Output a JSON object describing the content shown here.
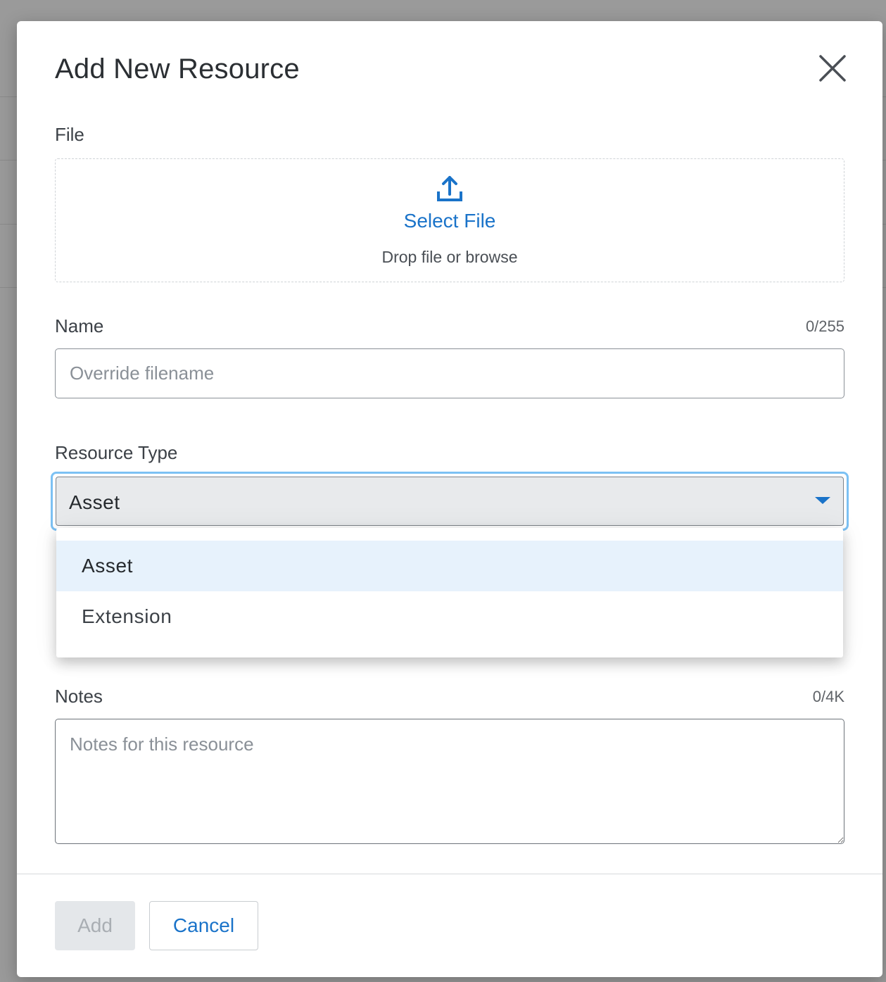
{
  "dialog": {
    "title": "Add New Resource"
  },
  "file_field": {
    "label": "File",
    "select_label": "Select File",
    "hint": "Drop file or browse",
    "icon": "upload-icon"
  },
  "name_field": {
    "label": "Name",
    "counter": "0/255",
    "value": "",
    "placeholder": "Override filename"
  },
  "resource_type": {
    "label": "Resource Type",
    "selected": "Asset",
    "options": [
      "Asset",
      "Extension"
    ]
  },
  "notes_field": {
    "label": "Notes",
    "counter": "0/4K",
    "value": "",
    "placeholder": "Notes for this resource"
  },
  "footer": {
    "add_label": "Add",
    "cancel_label": "Cancel",
    "add_disabled": true
  },
  "colors": {
    "accent": "#1a73c9",
    "focus_ring": "#7cc1f3",
    "selected_option_bg": "#e7f2fc"
  }
}
